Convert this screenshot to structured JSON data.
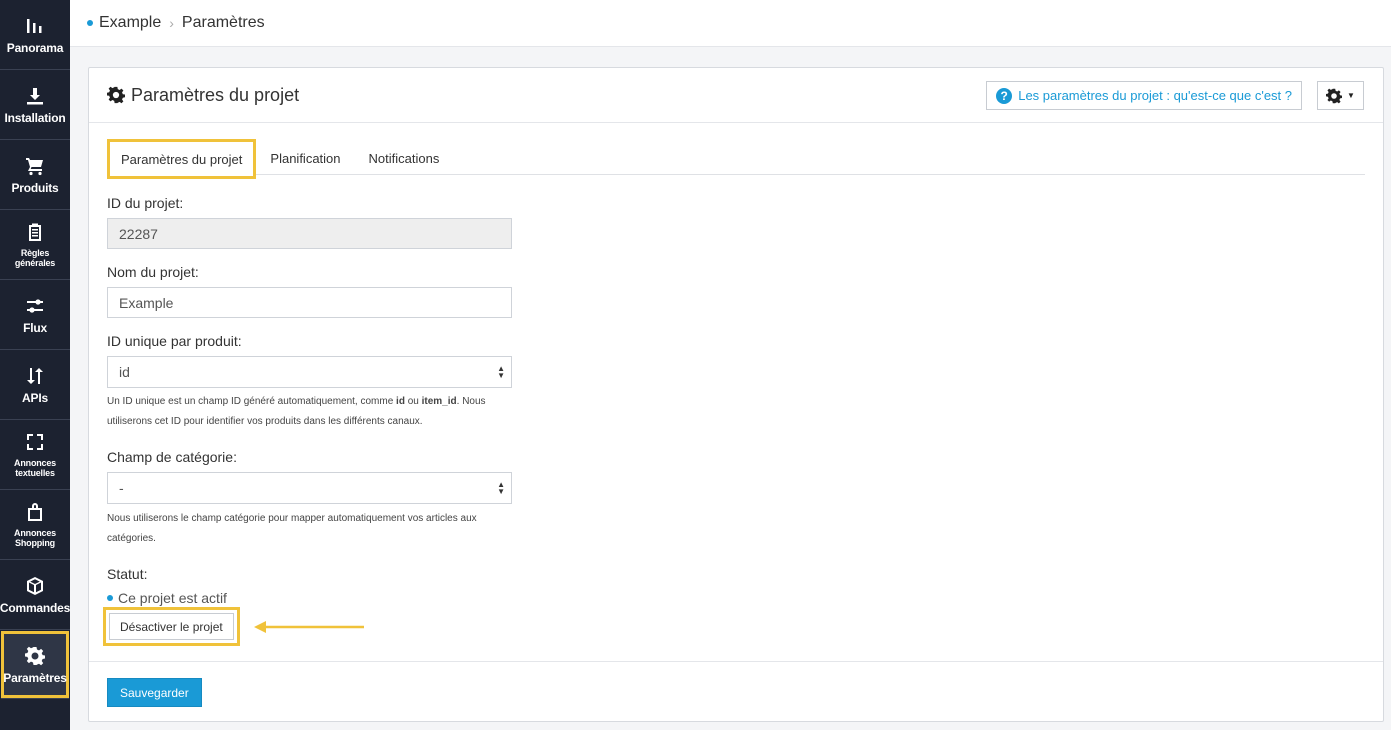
{
  "sidebar": {
    "items": [
      {
        "label": "Panorama",
        "icon": "chart-bars-icon"
      },
      {
        "label": "Installation",
        "icon": "download-icon"
      },
      {
        "label": "Produits",
        "icon": "cart-icon"
      },
      {
        "label": "Règles générales",
        "icon": "clipboard-icon"
      },
      {
        "label": "Flux",
        "icon": "sliders-icon"
      },
      {
        "label": "APIs",
        "icon": "arrows-updown-icon"
      },
      {
        "label": "Annonces textuelles",
        "icon": "expand-icon"
      },
      {
        "label": "Annonces Shopping",
        "icon": "bag-icon"
      },
      {
        "label": "Commandes",
        "icon": "box-icon"
      },
      {
        "label": "Paramètres",
        "icon": "gear-icon",
        "active": true
      }
    ]
  },
  "breadcrumb": {
    "project": "Example",
    "page": "Paramètres"
  },
  "card": {
    "title": "Paramètres du projet",
    "help_label": "Les paramètres du projet : qu'est-ce que c'est ?"
  },
  "tabs": [
    {
      "label": "Paramètres du projet",
      "active": true
    },
    {
      "label": "Planification"
    },
    {
      "label": "Notifications"
    }
  ],
  "form": {
    "project_id_label": "ID du projet:",
    "project_id_value": "22287",
    "project_name_label": "Nom du projet:",
    "project_name_value": "Example",
    "unique_id_label": "ID unique par produit:",
    "unique_id_value": "id",
    "unique_id_help_1": "Un ID unique est un champ ID généré automatiquement, comme ",
    "unique_id_help_id": "id",
    "unique_id_help_2": " ou ",
    "unique_id_help_item": "item_id",
    "unique_id_help_3": ". Nous utiliserons cet ID pour identifier vos produits dans les différents canaux.",
    "category_label": "Champ de catégorie:",
    "category_value": "-",
    "category_help": "Nous utiliserons le champ catégorie pour mapper automatiquement vos articles aux catégories.",
    "status_label": "Statut:",
    "status_text": "Ce projet est actif",
    "deactivate_label": "Désactiver le projet"
  },
  "save_label": "Sauvegarder",
  "colors": {
    "accent": "#1a9ad6",
    "highlight": "#f0c23a",
    "sidebar": "#1c2230"
  }
}
